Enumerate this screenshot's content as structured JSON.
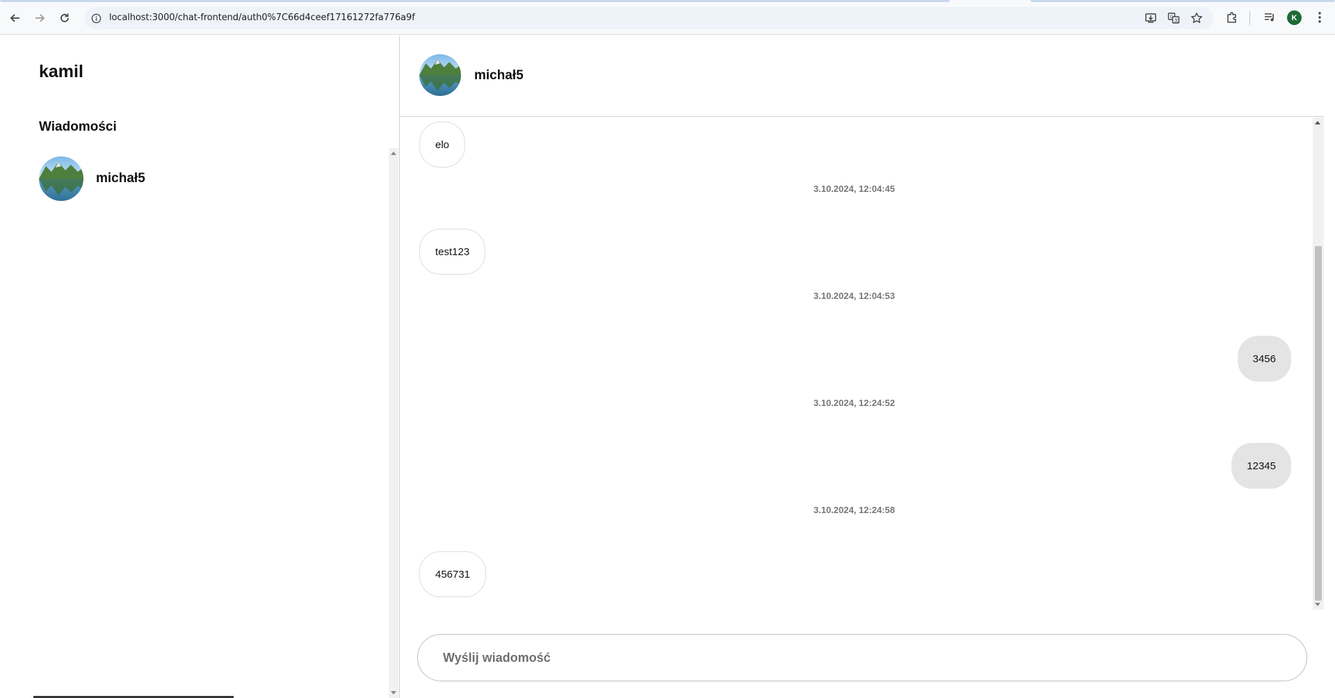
{
  "browser": {
    "url": "localhost:3000/chat-frontend/auth0%7C66d4ceef17161272fa776a9f",
    "profile_initial": "K",
    "icons": [
      "back-icon",
      "forward-icon",
      "reload-icon",
      "site-info-icon",
      "install-app-icon",
      "translate-icon",
      "bookmark-star-icon",
      "extensions-icon",
      "media-controls-icon",
      "menu-icon"
    ]
  },
  "sidebar": {
    "username": "kamil",
    "section_title": "Wiadomości",
    "contacts": [
      {
        "name": "michał5"
      }
    ]
  },
  "chat": {
    "contact_name": "michał5",
    "messages": [
      {
        "text": "elo",
        "direction": "incoming"
      },
      {
        "timestamp": "3.10.2024, 12:04:45"
      },
      {
        "text": "test123",
        "direction": "incoming"
      },
      {
        "timestamp": "3.10.2024, 12:04:53"
      },
      {
        "text": "3456",
        "direction": "outgoing"
      },
      {
        "timestamp": "3.10.2024, 12:24:52"
      },
      {
        "text": "12345",
        "direction": "outgoing"
      },
      {
        "timestamp": "3.10.2024, 12:24:58"
      },
      {
        "text": "456731",
        "direction": "incoming"
      }
    ],
    "input": {
      "placeholder": "Wyślij wiadomość",
      "value": ""
    }
  },
  "colors": {
    "outgoing_bubble": "#e4e4e4",
    "incoming_border": "#dedede",
    "timestamp": "#777777",
    "profile": "#1e6b35"
  }
}
